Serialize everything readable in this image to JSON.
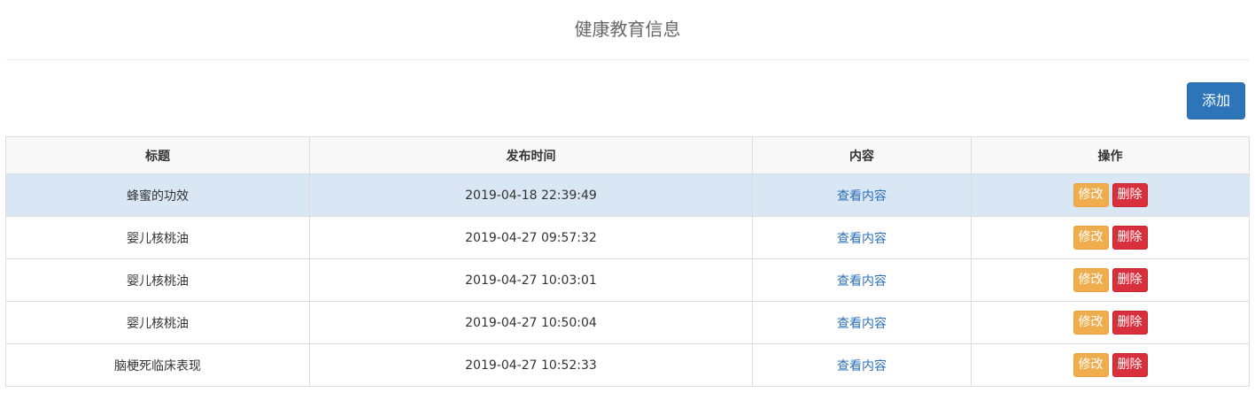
{
  "header": {
    "title": "健康教育信息"
  },
  "toolbar": {
    "add_label": "添加"
  },
  "table": {
    "columns": [
      "标题",
      "发布时间",
      "内容",
      "操作"
    ],
    "rows": [
      {
        "title": "蜂蜜的功效",
        "time": "2019-04-18 22:39:49",
        "content_link": "查看内容",
        "edit": "修改",
        "delete": "删除"
      },
      {
        "title": "婴儿核桃油",
        "time": "2019-04-27 09:57:32",
        "content_link": "查看内容",
        "edit": "修改",
        "delete": "删除"
      },
      {
        "title": "婴儿核桃油",
        "time": "2019-04-27 10:03:01",
        "content_link": "查看内容",
        "edit": "修改",
        "delete": "删除"
      },
      {
        "title": "婴儿核桃油",
        "time": "2019-04-27 10:50:04",
        "content_link": "查看内容",
        "edit": "修改",
        "delete": "删除"
      },
      {
        "title": "脑梗死临床表现",
        "time": "2019-04-27 10:52:33",
        "content_link": "查看内容",
        "edit": "修改",
        "delete": "删除"
      }
    ]
  },
  "colors": {
    "primary": "#2d74b8",
    "warning": "#f0ad4e",
    "danger": "#d9303e",
    "link": "#2a6fb6",
    "row_highlight": "#d9e6f3"
  }
}
